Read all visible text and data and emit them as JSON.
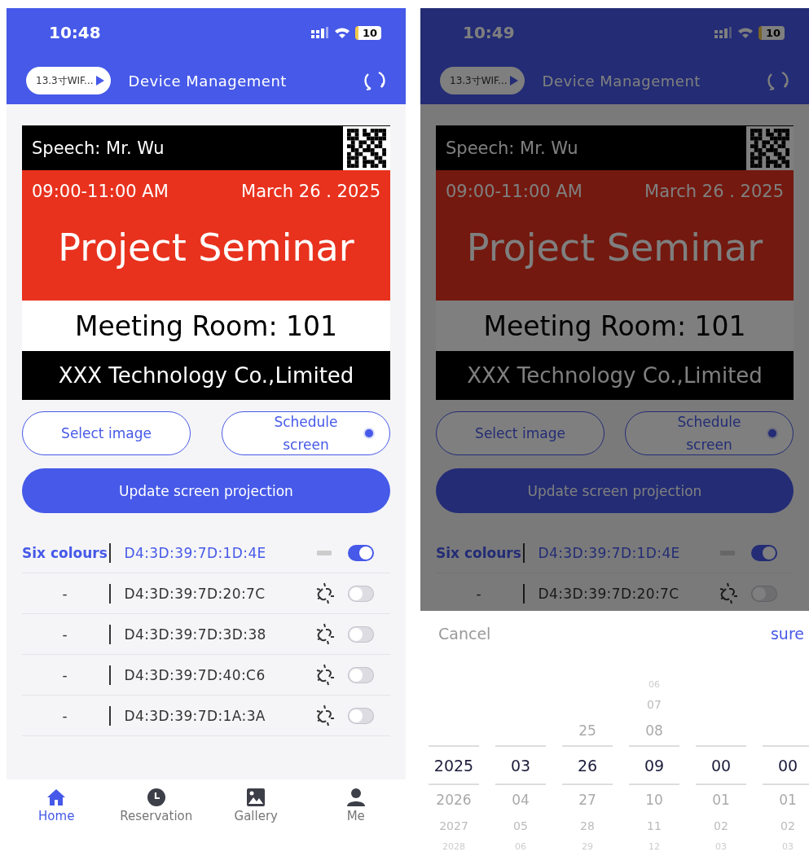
{
  "screens": [
    {
      "status_bar": {
        "time": "10:48",
        "battery": "10"
      },
      "header": {
        "device_chip": "13.3寸WIF...",
        "title": "Device Management"
      },
      "poster": {
        "speaker": "Speech: Mr. Wu",
        "time": "09:00-11:00 AM",
        "date": "March 26 . 2025",
        "title": "Project Seminar",
        "room": "Meeting Room: 101",
        "company": "XXX Technology Co.,Limited"
      },
      "select_button": {
        "label": "Select image"
      },
      "schedule_button": {
        "label": "Schedule screen",
        "checked": true
      },
      "update_button": {
        "label": "Update screen projection"
      },
      "devices": [
        {
          "name": "Six colours",
          "mac": "D4:3D:39:7D:1D:4E",
          "selected": true,
          "connected": true,
          "on": true
        },
        {
          "name": "-",
          "mac": "D4:3D:39:7D:20:7C",
          "selected": false,
          "connected": false,
          "on": false
        },
        {
          "name": "-",
          "mac": "D4:3D:39:7D:3D:38",
          "selected": false,
          "connected": false,
          "on": false
        },
        {
          "name": "-",
          "mac": "D4:3D:39:7D:40:C6",
          "selected": false,
          "connected": false,
          "on": false
        },
        {
          "name": "-",
          "mac": "D4:3D:39:7D:1A:3A",
          "selected": false,
          "connected": false,
          "on": false
        }
      ],
      "tab_bar": [
        {
          "label": "Home",
          "selected": true
        },
        {
          "label": "Reservation",
          "selected": false
        },
        {
          "label": "Gallery",
          "selected": false
        },
        {
          "label": "Me",
          "selected": false
        }
      ]
    },
    {
      "status_bar": {
        "time": "10:49",
        "battery": "10"
      },
      "header": {
        "device_chip": "13.3寸WIF...",
        "title": "Device Management"
      },
      "poster": {
        "speaker": "Speech: Mr. Wu",
        "time": "09:00-11:00 AM",
        "date": "March 26 . 2025",
        "title": "Project Seminar",
        "room": "Meeting Room: 101",
        "company": "XXX Technology Co.,Limited"
      },
      "select_button": {
        "label": "Select image"
      },
      "schedule_button": {
        "label": "Schedule screen",
        "checked": true
      },
      "update_button": {
        "label": "Update screen projection"
      },
      "devices": [
        {
          "name": "Six colours",
          "mac": "D4:3D:39:7D:1D:4E",
          "selected": true,
          "connected": true,
          "on": true
        },
        {
          "name": "-",
          "mac": "D4:3D:39:7D:20:7C",
          "selected": false,
          "connected": false,
          "on": false
        }
      ],
      "picker": {
        "cancel": "Cancel",
        "confirm": "sure",
        "columns": [
          {
            "items": [
              {
                "label": "2025",
                "selected": true
              },
              {
                "label": "2026",
                "selected": false
              },
              {
                "label": "2027",
                "selected": false
              },
              {
                "label": "2028",
                "selected": false
              }
            ]
          },
          {
            "items": [
              {
                "label": "03",
                "selected": true
              },
              {
                "label": "04",
                "selected": false
              },
              {
                "label": "05",
                "selected": false
              },
              {
                "label": "06",
                "selected": false
              }
            ]
          },
          {
            "items": [
              {
                "label": "25",
                "selected": false
              },
              {
                "label": "26",
                "selected": true
              },
              {
                "label": "27",
                "selected": false
              },
              {
                "label": "28",
                "selected": false
              },
              {
                "label": "29",
                "selected": false
              }
            ]
          },
          {
            "items": [
              {
                "label": "06",
                "selected": false
              },
              {
                "label": "07",
                "selected": false
              },
              {
                "label": "08",
                "selected": false
              },
              {
                "label": "09",
                "selected": true
              },
              {
                "label": "10",
                "selected": false
              },
              {
                "label": "11",
                "selected": false
              },
              {
                "label": "12",
                "selected": false
              }
            ]
          },
          {
            "items": [
              {
                "label": "00",
                "selected": true
              },
              {
                "label": "01",
                "selected": false
              },
              {
                "label": "02",
                "selected": false
              },
              {
                "label": "03",
                "selected": false
              }
            ]
          },
          {
            "items": [
              {
                "label": "00",
                "selected": true
              },
              {
                "label": "01",
                "selected": false
              },
              {
                "label": "02",
                "selected": false
              },
              {
                "label": "03",
                "selected": false
              }
            ]
          }
        ]
      }
    }
  ]
}
